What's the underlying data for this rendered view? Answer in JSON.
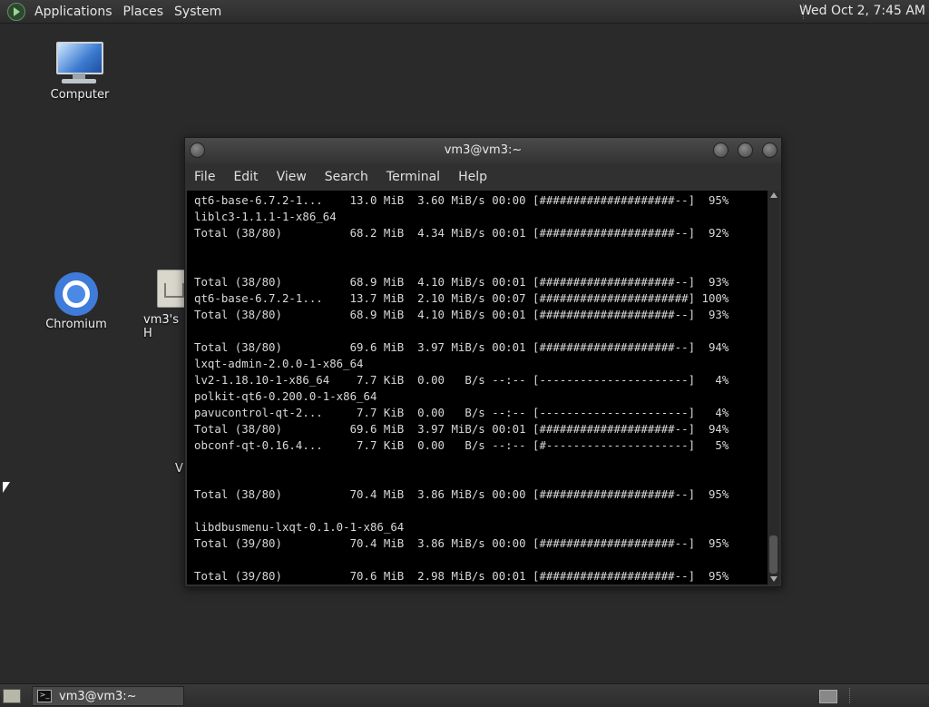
{
  "top_panel": {
    "menus": [
      "Applications",
      "Places",
      "System"
    ],
    "clock": "Wed Oct  2,  7:45 AM"
  },
  "desktop": {
    "icons": [
      {
        "label": "Computer",
        "icon": "computer-icon"
      },
      {
        "label": "Chromium",
        "icon": "chromium-icon"
      },
      {
        "label": "vm3's H",
        "icon": "home-folder-icon"
      }
    ],
    "stray_text": "V"
  },
  "terminal_window": {
    "title": "vm3@vm3:~",
    "menu": [
      "File",
      "Edit",
      "View",
      "Search",
      "Terminal",
      "Help"
    ],
    "lines": [
      "qt6-base-6.7.2-1...    13.0 MiB  3.60 MiB/s 00:00 [####################--]  95%",
      "liblc3-1.1.1-1-x86_64",
      "Total (38/80)          68.2 MiB  4.34 MiB/s 00:01 [####################--]  92%",
      "",
      "",
      "Total (38/80)          68.9 MiB  4.10 MiB/s 00:01 [####################--]  93%",
      "qt6-base-6.7.2-1...    13.7 MiB  2.10 MiB/s 00:07 [######################] 100%",
      "Total (38/80)          68.9 MiB  4.10 MiB/s 00:01 [####################--]  93%",
      "",
      "Total (38/80)          69.6 MiB  3.97 MiB/s 00:01 [####################--]  94%",
      "lxqt-admin-2.0.0-1-x86_64",
      "lv2-1.18.10-1-x86_64    7.7 KiB  0.00   B/s --:-- [----------------------]   4%",
      "polkit-qt6-0.200.0-1-x86_64",
      "pavucontrol-qt-2...     7.7 KiB  0.00   B/s --:-- [----------------------]   4%",
      "Total (38/80)          69.6 MiB  3.97 MiB/s 00:01 [####################--]  94%",
      "obconf-qt-0.16.4...     7.7 KiB  0.00   B/s --:-- [#---------------------]   5%",
      "",
      "",
      "Total (38/80)          70.4 MiB  3.86 MiB/s 00:00 [####################--]  95%",
      "",
      "libdbusmenu-lxqt-0.1.0-1-x86_64",
      "Total (39/80)          70.4 MiB  3.86 MiB/s 00:00 [####################--]  95%",
      "",
      "Total (39/80)          70.6 MiB  2.98 MiB/s 00:01 [####################--]  95%"
    ]
  },
  "taskbar": {
    "task_label": "vm3@vm3:~"
  }
}
